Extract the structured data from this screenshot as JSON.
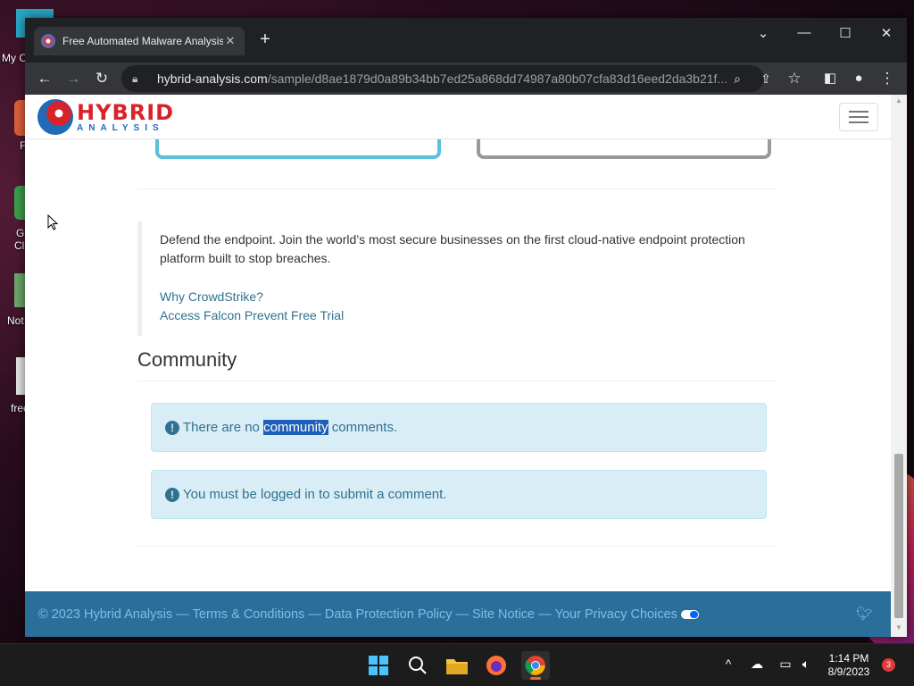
{
  "desktop": {
    "icons": [
      {
        "label": "My C"
      },
      {
        "label": "F"
      },
      {
        "label": "G"
      },
      {
        "label": "Cl"
      },
      {
        "label": "Not"
      },
      {
        "label": "free"
      }
    ]
  },
  "browser": {
    "tab_title": "Free Automated Malware Analysis",
    "url_host": "hybrid-analysis.com",
    "url_path": "/sample/d8ae1879d0a89b34bb7ed25a868dd74987a80b07cfa83d16eed2da3b21f..."
  },
  "site": {
    "logo_line1": "HYBRID",
    "logo_line2": "ANALYSIS"
  },
  "promo": {
    "text": "Defend the endpoint. Join the world’s most secure businesses on the first cloud-native endpoint protection platform built to stop breaches.",
    "link1": "Why CrowdStrike?",
    "link2": "Access Falcon Prevent Free Trial"
  },
  "community": {
    "heading": "Community",
    "alert1_before": "There are no ",
    "alert1_selected": "community",
    "alert1_after": " comments.",
    "alert2_before": "You must be ",
    "alert2_link": "logged in",
    "alert2_after": " to submit a comment."
  },
  "footer": {
    "copyright": "© 2023 Hybrid Analysis",
    "sep": "—",
    "terms": "Terms & Conditions",
    "data_protection": "Data Protection Policy",
    "site_notice": "Site Notice",
    "privacy_choices": "Your Privacy Choices"
  },
  "taskbar": {
    "time": "1:14 PM",
    "date": "8/9/2023",
    "notification_count": "3"
  },
  "colors": {
    "link": "#31708f",
    "alert_bg": "#d9edf7",
    "footer_bg": "#2a6e9a",
    "logo_red": "#d8232a",
    "logo_blue": "#1e6bb8"
  }
}
